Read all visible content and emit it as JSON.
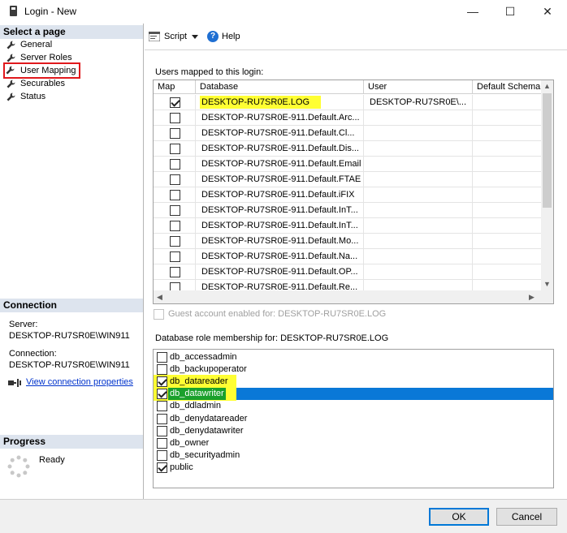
{
  "window": {
    "title": "Login - New",
    "minimize": "—",
    "maximize": "☐",
    "close": "✕"
  },
  "left": {
    "select_page_header": "Select a page",
    "pages": [
      {
        "label": "General"
      },
      {
        "label": "Server Roles"
      },
      {
        "label": "User Mapping",
        "selected": true
      },
      {
        "label": "Securables"
      },
      {
        "label": "Status"
      }
    ],
    "connection_header": "Connection",
    "server_label": "Server:",
    "server_value": "DESKTOP-RU7SR0E\\WIN911",
    "connection_label": "Connection:",
    "connection_value": "DESKTOP-RU7SR0E\\WIN911",
    "view_connection_link": "View connection properties",
    "progress_header": "Progress",
    "progress_status": "Ready"
  },
  "toolbar": {
    "script_label": "Script",
    "help_label": "Help"
  },
  "users_mapped": {
    "label": "Users mapped to this login:",
    "columns": [
      "Map",
      "Database",
      "User",
      "Default Schema"
    ],
    "rows": [
      {
        "map": true,
        "database": "DESKTOP-RU7SR0E.LOG",
        "user": "DESKTOP-RU7SR0E\\...",
        "schema": "",
        "highlight": true
      },
      {
        "map": false,
        "database": "DESKTOP-RU7SR0E-911.Default.Arc...",
        "user": "",
        "schema": ""
      },
      {
        "map": false,
        "database": "DESKTOP-RU7SR0E-911.Default.Cl...",
        "user": "",
        "schema": ""
      },
      {
        "map": false,
        "database": "DESKTOP-RU7SR0E-911.Default.Dis...",
        "user": "",
        "schema": ""
      },
      {
        "map": false,
        "database": "DESKTOP-RU7SR0E-911.Default.Email",
        "user": "",
        "schema": ""
      },
      {
        "map": false,
        "database": "DESKTOP-RU7SR0E-911.Default.FTAE",
        "user": "",
        "schema": ""
      },
      {
        "map": false,
        "database": "DESKTOP-RU7SR0E-911.Default.iFIX",
        "user": "",
        "schema": ""
      },
      {
        "map": false,
        "database": "DESKTOP-RU7SR0E-911.Default.InT...",
        "user": "",
        "schema": ""
      },
      {
        "map": false,
        "database": "DESKTOP-RU7SR0E-911.Default.InT...",
        "user": "",
        "schema": ""
      },
      {
        "map": false,
        "database": "DESKTOP-RU7SR0E-911.Default.Mo...",
        "user": "",
        "schema": ""
      },
      {
        "map": false,
        "database": "DESKTOP-RU7SR0E-911.Default.Na...",
        "user": "",
        "schema": ""
      },
      {
        "map": false,
        "database": "DESKTOP-RU7SR0E-911.Default.OP...",
        "user": "",
        "schema": ""
      },
      {
        "map": false,
        "database": "DESKTOP-RU7SR0E-911.Default.Re...",
        "user": "",
        "schema": ""
      }
    ]
  },
  "guest": {
    "checked": false,
    "label": "Guest account enabled for: DESKTOP-RU7SR0E.LOG"
  },
  "roles": {
    "label": "Database role membership for: DESKTOP-RU7SR0E.LOG",
    "items": [
      {
        "name": "db_accessadmin",
        "checked": false
      },
      {
        "name": "db_backupoperator",
        "checked": false
      },
      {
        "name": "db_datareader",
        "checked": true,
        "highlight": true
      },
      {
        "name": "db_datawriter",
        "checked": true,
        "highlight": true,
        "selected": true
      },
      {
        "name": "db_ddladmin",
        "checked": false
      },
      {
        "name": "db_denydatareader",
        "checked": false
      },
      {
        "name": "db_denydatawriter",
        "checked": false
      },
      {
        "name": "db_owner",
        "checked": false
      },
      {
        "name": "db_securityadmin",
        "checked": false
      },
      {
        "name": "public",
        "checked": true
      }
    ]
  },
  "buttons": {
    "ok": "OK",
    "cancel": "Cancel"
  },
  "colors": {
    "selection_blue": "#0a78d7",
    "highlight_yellow": "#ffff33",
    "annotation_red": "#e0181c",
    "link_blue": "#0033cc"
  }
}
